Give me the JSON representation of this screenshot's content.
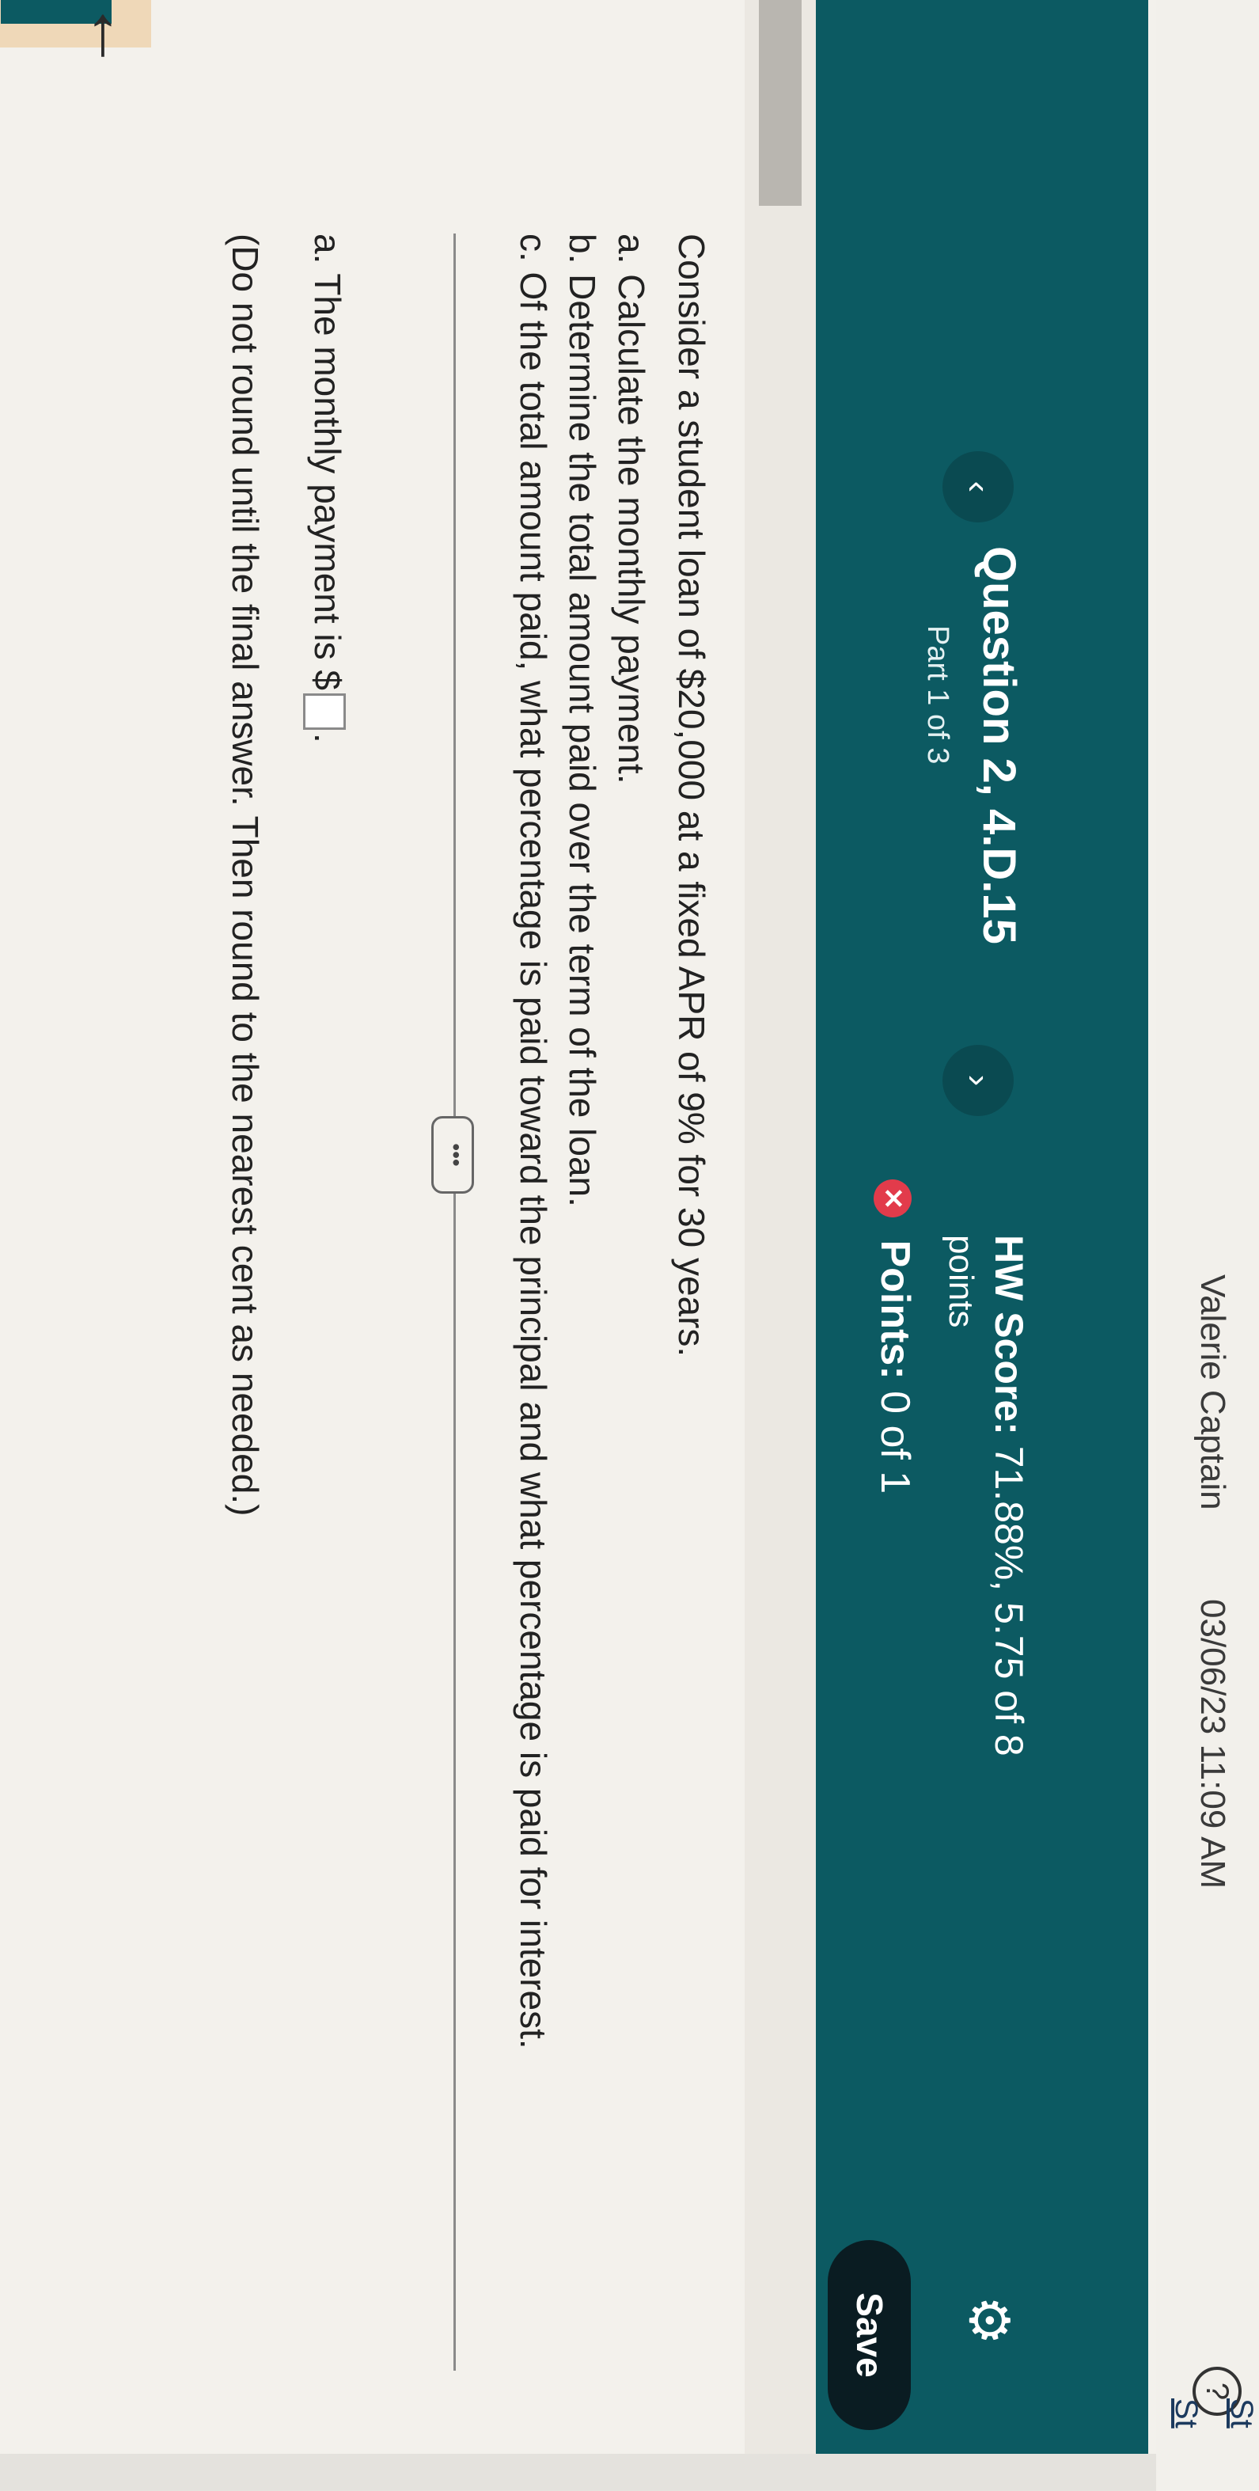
{
  "topbar": {
    "user": "Valerie Captain",
    "datetime": "03/06/23 11:09 AM",
    "help_icon": "?"
  },
  "header": {
    "prev_icon": "‹",
    "next_icon": "›",
    "question_title": "Question 2, 4.D.15",
    "part_label": "Part 1 of 3",
    "hw_score_label": "HW Score:",
    "hw_score_value": "71.88%, 5.75 of 8",
    "hw_score_unit": "points",
    "points_label": "Points:",
    "points_value": "0 of 1",
    "save_label": "Save"
  },
  "question": {
    "intro": "Consider a student loan of $20,000 at a fixed APR of 9% for 30 years.",
    "parts": [
      "a. Calculate the monthly payment.",
      "b. Determine the total amount paid over the term of the loan.",
      "c. Of the total amount paid, what percentage is paid toward the principal and what percentage is paid for interest."
    ],
    "more_label": "•••"
  },
  "answer": {
    "prompt": "a. The monthly payment is $",
    "input_value": "",
    "period": ".",
    "instruction": "(Do not round until the final answer. Then round to the nearest cent as needed.)"
  },
  "edge": {
    "link_a": "St",
    "link_b": "St"
  },
  "colors": {
    "banner": "#0c5a62",
    "save_button": "#0a1c22",
    "error_badge": "#e23b4b"
  }
}
